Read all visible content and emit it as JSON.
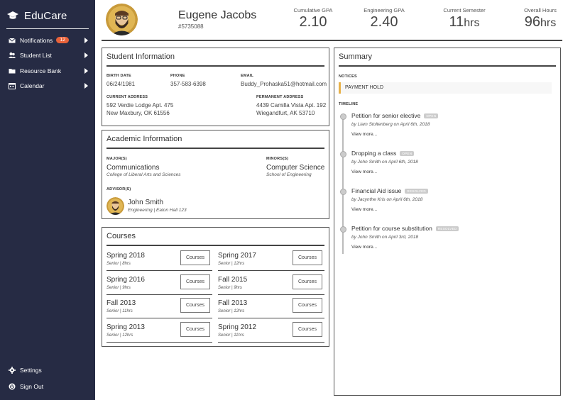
{
  "app": {
    "name": "EduCare"
  },
  "sidebar": {
    "items": [
      {
        "label": "Notifications",
        "icon": "envelope-icon",
        "badge": "12"
      },
      {
        "label": "Student List",
        "icon": "users-icon"
      },
      {
        "label": "Resource Bank",
        "icon": "folder-icon"
      },
      {
        "label": "Calendar",
        "icon": "calendar-icon"
      }
    ],
    "bottom": [
      {
        "label": "Settings",
        "icon": "gear-icon"
      },
      {
        "label": "Sign Out",
        "icon": "power-icon"
      }
    ]
  },
  "student": {
    "name": "Eugene Jacobs",
    "id": "#5735088"
  },
  "stats": [
    {
      "label": "Cumulative GPA",
      "value": "2.10",
      "unit": ""
    },
    {
      "label": "Engineering GPA",
      "value": "2.40",
      "unit": ""
    },
    {
      "label": "Current Semester",
      "value": "11",
      "unit": "hrs"
    },
    {
      "label": "Overall Hours",
      "value": "96",
      "unit": "hrs"
    }
  ],
  "student_info": {
    "title": "Student Information",
    "birth_date_label": "BIRTH DATE",
    "birth_date": "06/24/1981",
    "phone_label": "PHONE",
    "phone": "357-583-6398",
    "email_label": "EMAIL",
    "email": "Buddy_Prohaska51@hotmail.com",
    "current_address_label": "CURRENT ADDRESS",
    "current_address_1": "592 Verdie Lodge Apt. 475",
    "current_address_2": "New Maxbury, OK 61556",
    "permanent_address_label": "PERMANENT ADDRESS",
    "permanent_address_1": "4439 Camilla Vista Apt. 192",
    "permanent_address_2": "Wiegandfurt, AK 53710"
  },
  "academic": {
    "title": "Academic Information",
    "majors_label": "MAJOR(S)",
    "major": "Communications",
    "major_school": "College of Liberal Arts and Sciences",
    "minors_label": "MINORS(S)",
    "minor": "Computer Science",
    "minor_school": "School of Engineering",
    "advisors_label": "ADVISOR(S)",
    "advisor_name": "John Smith",
    "advisor_detail": "Engineering | Eaton Hall 123"
  },
  "courses": {
    "title": "Courses",
    "button_label": "Courses",
    "items": [
      {
        "term": "Spring 2018",
        "detail": "Senior | 8hrs"
      },
      {
        "term": "Spring 2017",
        "detail": "Senior | 12hrs"
      },
      {
        "term": "Spring 2016",
        "detail": "Senior | 9hrs"
      },
      {
        "term": "Fall 2015",
        "detail": "Senior | 9hrs"
      },
      {
        "term": "Fall 2013",
        "detail": "Senior | 11hrs"
      },
      {
        "term": "Fall 2013",
        "detail": "Senior | 12hrs"
      },
      {
        "term": "Spring 2013",
        "detail": "Senior | 12hrs"
      },
      {
        "term": "Spring 2012",
        "detail": "Senior | 11hrs"
      }
    ]
  },
  "summary": {
    "title": "Summary",
    "notices_label": "NOTICES",
    "notice": "PAYMENT HOLD",
    "timeline_label": "TIMELINE",
    "view_more": "View more...",
    "timeline": [
      {
        "title": "Petition for senior elective",
        "tag": "OPEN",
        "by": "by Liam Stoltenberg on April 6th, 2018"
      },
      {
        "title": "Dropping a class",
        "tag": "OPEN",
        "by": "by John Smith on April 6th, 2018"
      },
      {
        "title": "Financial Aid issue",
        "tag": "RESOLVED",
        "by": "by Jacynthe Kris on April 6th, 2018"
      },
      {
        "title": "Petition for course substitution",
        "tag": "RESOLVED",
        "by": "by John Smith on April 3rd, 2018"
      }
    ]
  },
  "colors": {
    "sidebar": "#262b44",
    "badge": "#e8623a",
    "notice_accent": "#e8b24a"
  }
}
